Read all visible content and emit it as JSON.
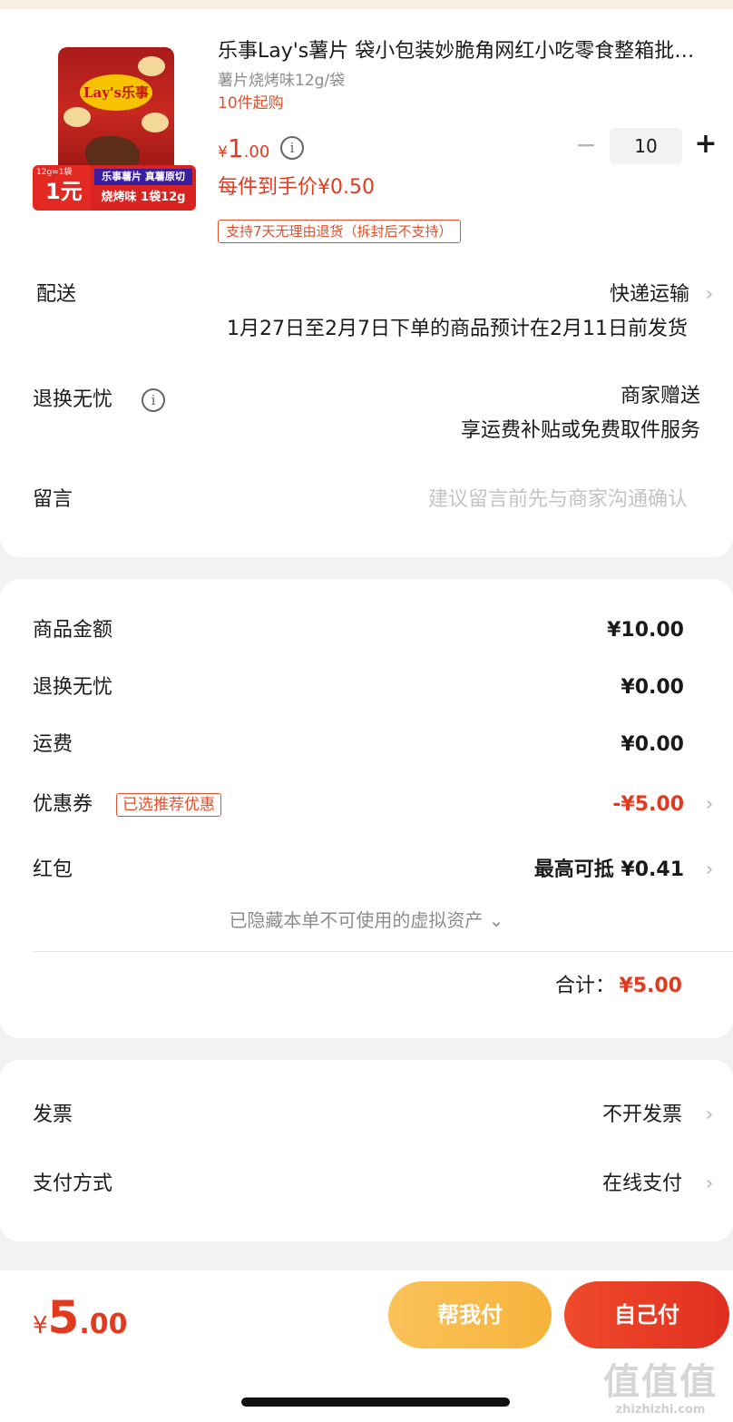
{
  "product": {
    "title": "乐事Lay's薯片 袋小包装妙脆角网红小吃零食整箱批发休闲食品",
    "spec": "薯片烧烤味12g/袋",
    "min_purchase": "10件起购",
    "price_currency": "¥",
    "price_int": "1",
    "price_dec": ".00",
    "final_price": "每件到手价¥0.50",
    "return_policy": "支持7天无理由退货（拆封后不支持）",
    "quantity": "10",
    "minus_symbol": "−",
    "plus_symbol": "+",
    "info_symbol": "i",
    "thumb": {
      "brand": "Lay's乐事",
      "promo_small": "12g=1袋",
      "promo_big": "1元",
      "promo_line1": "乐事薯片 真薯原切",
      "promo_line2": "烧烤味 1袋12g"
    }
  },
  "delivery": {
    "label": "配送",
    "method": "快递运输",
    "estimate": "1月27日至2月7日下单的商品预计在2月11日前发货"
  },
  "worry_free": {
    "label": "退换无忧",
    "value_line1": "商家赠送",
    "value_line2": "享运费补贴或免费取件服务"
  },
  "message": {
    "label": "留言",
    "placeholder": "建议留言前先与商家沟通确认"
  },
  "amounts": {
    "goods_label": "商品金额",
    "goods_value": "¥10.00",
    "worry_label": "退换无忧",
    "worry_value": "¥0.00",
    "shipping_label": "运费",
    "shipping_value": "¥0.00",
    "coupon_label": "优惠券",
    "coupon_tag": "已选推荐优惠",
    "coupon_value": "-¥5.00",
    "redpack_label": "红包",
    "redpack_value": "最高可抵 ¥0.41",
    "hidden_assets": "已隐藏本单不可使用的虚拟资产 ⌄",
    "total_label": "合计：",
    "total_value": "¥5.00"
  },
  "invoice": {
    "label": "发票",
    "value": "不开发票"
  },
  "payment": {
    "label": "支付方式",
    "value": "在线支付"
  },
  "bottom": {
    "currency": "¥",
    "total_int": "5",
    "total_dec": ".00",
    "help_pay": "帮我付",
    "self_pay": "自己付"
  },
  "watermark": {
    "glyphs": "值值值",
    "url": "zhizhizhi.com"
  },
  "chevron": "›",
  "colors": {
    "accent_red": "#e23a1f",
    "help_button": "#f6b33a",
    "self_button": "#e12f1f"
  }
}
